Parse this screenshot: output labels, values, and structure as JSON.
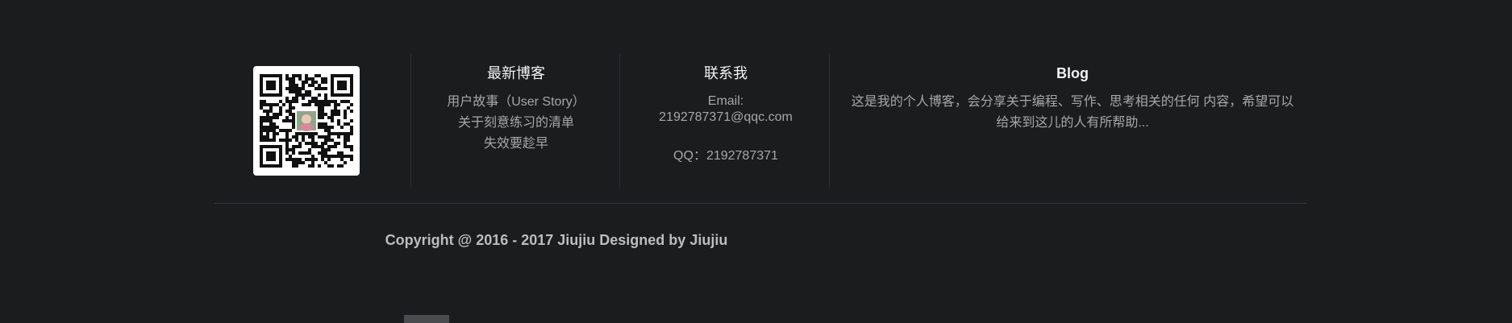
{
  "latest_posts": {
    "title": "最新博客",
    "items": [
      "用户故事（User Story）",
      "关于刻意练习的清单",
      "失效要趁早"
    ]
  },
  "contact": {
    "title": "联系我",
    "email_label": "Email:",
    "email": "2192787371@qqc.com",
    "qq": "QQ：2192787371"
  },
  "blog": {
    "title": "Blog",
    "description": "这是我的个人博客，会分享关于编程、写作、思考相关的任何 内容，希望可以给来到这儿的人有所帮助..."
  },
  "copyright": "Copyright @ 2016 - 2017 Jiujiu Designed by Jiujiu",
  "colors": {
    "background": "#1b1c1e",
    "title": "#f2f2f2",
    "body": "#a7a7a7"
  }
}
